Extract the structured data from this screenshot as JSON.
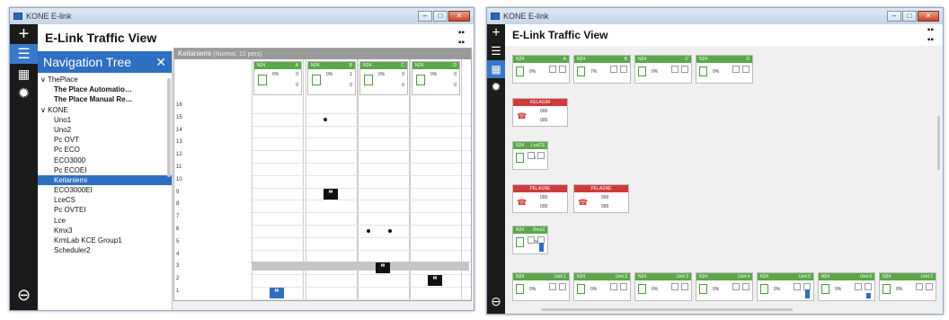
{
  "left_window": {
    "titlebar": "KONE E-link",
    "header_title": "E-Link Traffic View",
    "nav_title": "Navigation Tree",
    "tree": [
      {
        "label": "ThePlace",
        "level": "l0",
        "prefix": "∨ "
      },
      {
        "label": "The Place Automatio…",
        "level": "l1"
      },
      {
        "label": "The Place Manual Re…",
        "level": "l1"
      },
      {
        "label": "KONE",
        "level": "l0",
        "prefix": "∨ "
      },
      {
        "label": "Uno1",
        "level": "l2"
      },
      {
        "label": "Uno2",
        "level": "l2"
      },
      {
        "label": "Pc OVT",
        "level": "l2"
      },
      {
        "label": "Pc ECO",
        "level": "l2"
      },
      {
        "label": "ECO3000",
        "level": "l2"
      },
      {
        "label": "Pc ECOEI",
        "level": "l2"
      },
      {
        "label": "Keilaniemi",
        "level": "l2",
        "selected": true
      },
      {
        "label": "ECO3000EI",
        "level": "l2"
      },
      {
        "label": "LceCS",
        "level": "l2"
      },
      {
        "label": "Pc OVTEI",
        "level": "l2"
      },
      {
        "label": "Lce",
        "level": "l2"
      },
      {
        "label": "Kmx3",
        "level": "l2"
      },
      {
        "label": "KrmLab KCE Group1",
        "level": "l2"
      },
      {
        "label": "Scheduler2",
        "level": "l2"
      }
    ],
    "grid_title": "Keilaniemi",
    "grid_subtitle": "(Normal, 10 pers)",
    "floors": [
      "16",
      "15",
      "14",
      "13",
      "12",
      "11",
      "10",
      "9",
      "8",
      "7",
      "6",
      "5",
      "4",
      "3",
      "2",
      "1"
    ],
    "lifts": [
      {
        "group": "N24",
        "name": "A",
        "pct": "0%",
        "dir": "0",
        "count": "0"
      },
      {
        "group": "N24",
        "name": "B",
        "pct": "0%",
        "dir": "1",
        "count": "0"
      },
      {
        "group": "N24",
        "name": "C",
        "pct": "0%",
        "dir": "0",
        "count": "0"
      },
      {
        "group": "N24",
        "name": "D",
        "pct": "0%",
        "dir": "0",
        "count": "0"
      }
    ]
  },
  "right_window": {
    "titlebar": "KONE E-link",
    "header_title": "E-Link Traffic View",
    "top_cards": [
      {
        "group": "N24",
        "name": "A",
        "pct": "0%"
      },
      {
        "group": "N24",
        "name": "B",
        "pct": "7%"
      },
      {
        "group": "N24",
        "name": "C",
        "pct": "0%"
      },
      {
        "group": "N24",
        "name": "D",
        "pct": "0%"
      }
    ],
    "red_cards": [
      {
        "title": "KELAGIM",
        "v1": "000",
        "v2": "000"
      },
      {
        "title": "PELASNE",
        "v1": "000",
        "v2": "000"
      },
      {
        "title": "PELASNE",
        "v1": "000",
        "v2": "000"
      }
    ],
    "single_cards": [
      {
        "group": "N24",
        "name": "LceCS",
        "pct": "0%"
      },
      {
        "group": "N24",
        "name": "Kmx3",
        "pct": "30%"
      }
    ],
    "bottom_cards": [
      {
        "group": "N24",
        "name": "Unit 1",
        "pct": "0%"
      },
      {
        "group": "N24",
        "name": "Unit 2",
        "pct": "0%"
      },
      {
        "group": "N24",
        "name": "Unit 3",
        "pct": "0%"
      },
      {
        "group": "N24",
        "name": "Unit 4",
        "pct": "0%"
      },
      {
        "group": "N24",
        "name": "Unit 5",
        "pct": "0%"
      },
      {
        "group": "N24",
        "name": "Unit 6",
        "pct": "0%"
      },
      {
        "group": "N24",
        "name": "Unit 7",
        "pct": "0%"
      }
    ]
  },
  "colors": {
    "accent": "#2f6fc0",
    "ok": "#5aa84a",
    "alarm": "#d13a3a",
    "rail": "#1b1b1b"
  }
}
